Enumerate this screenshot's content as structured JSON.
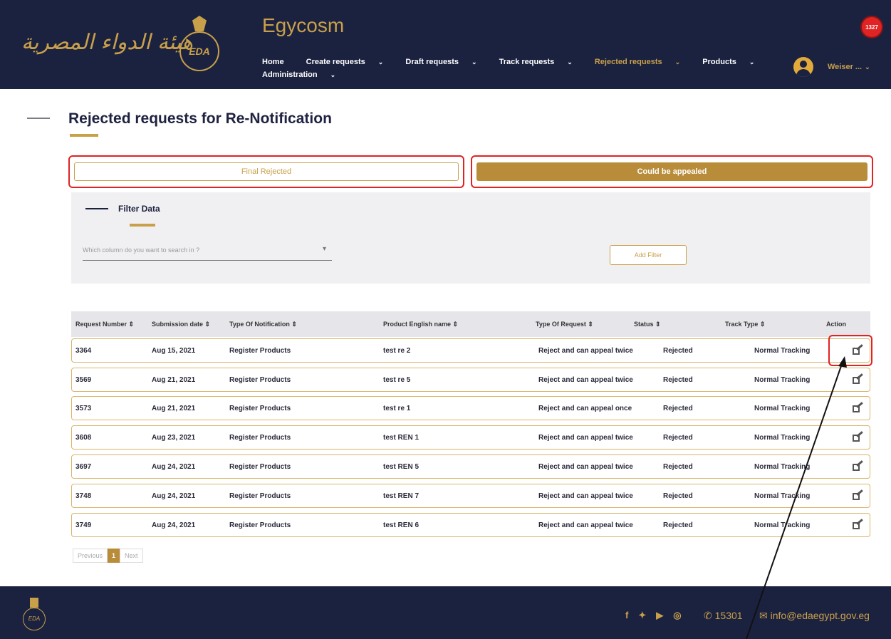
{
  "header": {
    "arabic_logo": "هيئة الدواء المصرية",
    "emblem_text": "EDA",
    "app_title": "Egycosm",
    "nav": [
      {
        "label": "Home"
      },
      {
        "label": "Create requests"
      },
      {
        "label": "Draft requests"
      },
      {
        "label": "Track requests"
      },
      {
        "label": "Rejected requests"
      },
      {
        "label": "Products"
      },
      {
        "label": "Administration"
      }
    ],
    "notification_count": "1327",
    "user_name": "Weiser ..."
  },
  "page_title": "Rejected requests for Re-Notification",
  "tabs": {
    "final_rejected": "Final Rejected",
    "could_be_appealed": "Could be appealed"
  },
  "filter": {
    "title": "Filter Data",
    "select_placeholder": "Which column do you want to search in ?",
    "add_filter": "Add Filter"
  },
  "table": {
    "headers": [
      "Request Number ⇕",
      "Submission date ⇕",
      "Type Of Notification ⇕",
      "Product English name ⇕",
      "Type Of Request ⇕",
      "Status ⇕",
      "Track Type ⇕",
      "Action"
    ],
    "rows": [
      {
        "number": "3364",
        "date": "Aug 15, 2021",
        "notification": "Register Products",
        "product": "test re 2",
        "request": "Reject and can appeal twice",
        "status": "Rejected",
        "track": "Normal Tracking"
      },
      {
        "number": "3569",
        "date": "Aug 21, 2021",
        "notification": "Register Products",
        "product": "test re 5",
        "request": "Reject and can appeal twice",
        "status": "Rejected",
        "track": "Normal Tracking"
      },
      {
        "number": "3573",
        "date": "Aug 21, 2021",
        "notification": "Register Products",
        "product": "test re 1",
        "request": "Reject and can appeal once",
        "status": "Rejected",
        "track": "Normal Tracking"
      },
      {
        "number": "3608",
        "date": "Aug 23, 2021",
        "notification": "Register Products",
        "product": "test REN 1",
        "request": "Reject and can appeal twice",
        "status": "Rejected",
        "track": "Normal Tracking"
      },
      {
        "number": "3697",
        "date": "Aug 24, 2021",
        "notification": "Register Products",
        "product": "test REN 5",
        "request": "Reject and can appeal twice",
        "status": "Rejected",
        "track": "Normal Tracking"
      },
      {
        "number": "3748",
        "date": "Aug 24, 2021",
        "notification": "Register Products",
        "product": "test REN 7",
        "request": "Reject and can appeal twice",
        "status": "Rejected",
        "track": "Normal Tracking"
      },
      {
        "number": "3749",
        "date": "Aug 24, 2021",
        "notification": "Register Products",
        "product": "test REN 6",
        "request": "Reject and can appeal twice",
        "status": "Rejected",
        "track": "Normal Tracking"
      }
    ]
  },
  "pagination": {
    "previous": "Previous",
    "current": "1",
    "next": "Next"
  },
  "footer": {
    "logo_text": "EDA",
    "social_icons": [
      "facebook-icon",
      "twitter-icon",
      "youtube-icon",
      "instagram-icon"
    ],
    "phone": "15301",
    "email": "info@edaegypt.gov.eg"
  },
  "colors": {
    "navy": "#1b2240",
    "gold": "#c9a04a",
    "highlight_red": "#e02323"
  }
}
